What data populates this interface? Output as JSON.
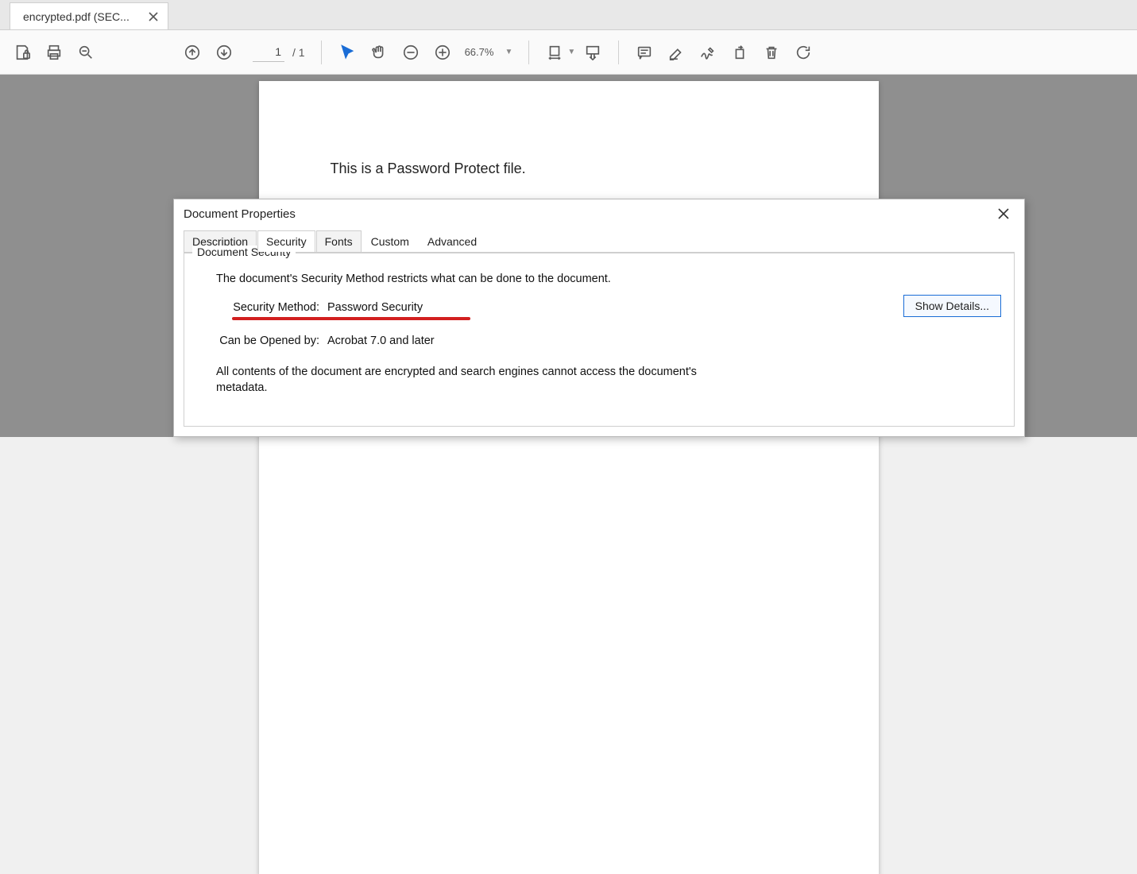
{
  "tab": {
    "title": "encrypted.pdf (SEC..."
  },
  "toolbar": {
    "page_current": "1",
    "page_total": "/ 1",
    "zoom": "66.7%"
  },
  "document": {
    "body_text": "This is a Password Protect file."
  },
  "dialog": {
    "title": "Document Properties",
    "tabs": {
      "description": "Description",
      "security": "Security",
      "fonts": "Fonts",
      "custom": "Custom",
      "advanced": "Advanced"
    },
    "fieldset_title": "Document Security",
    "intro": "The document's Security Method restricts what can be done to the document.",
    "security_method_label": "Security Method:",
    "security_method_value": "Password Security",
    "opened_by_label": "Can be Opened by:",
    "opened_by_value": "Acrobat 7.0 and later",
    "encrypt_note": "All contents of the document are encrypted and search engines cannot access the document's metadata.",
    "show_details": "Show Details..."
  }
}
